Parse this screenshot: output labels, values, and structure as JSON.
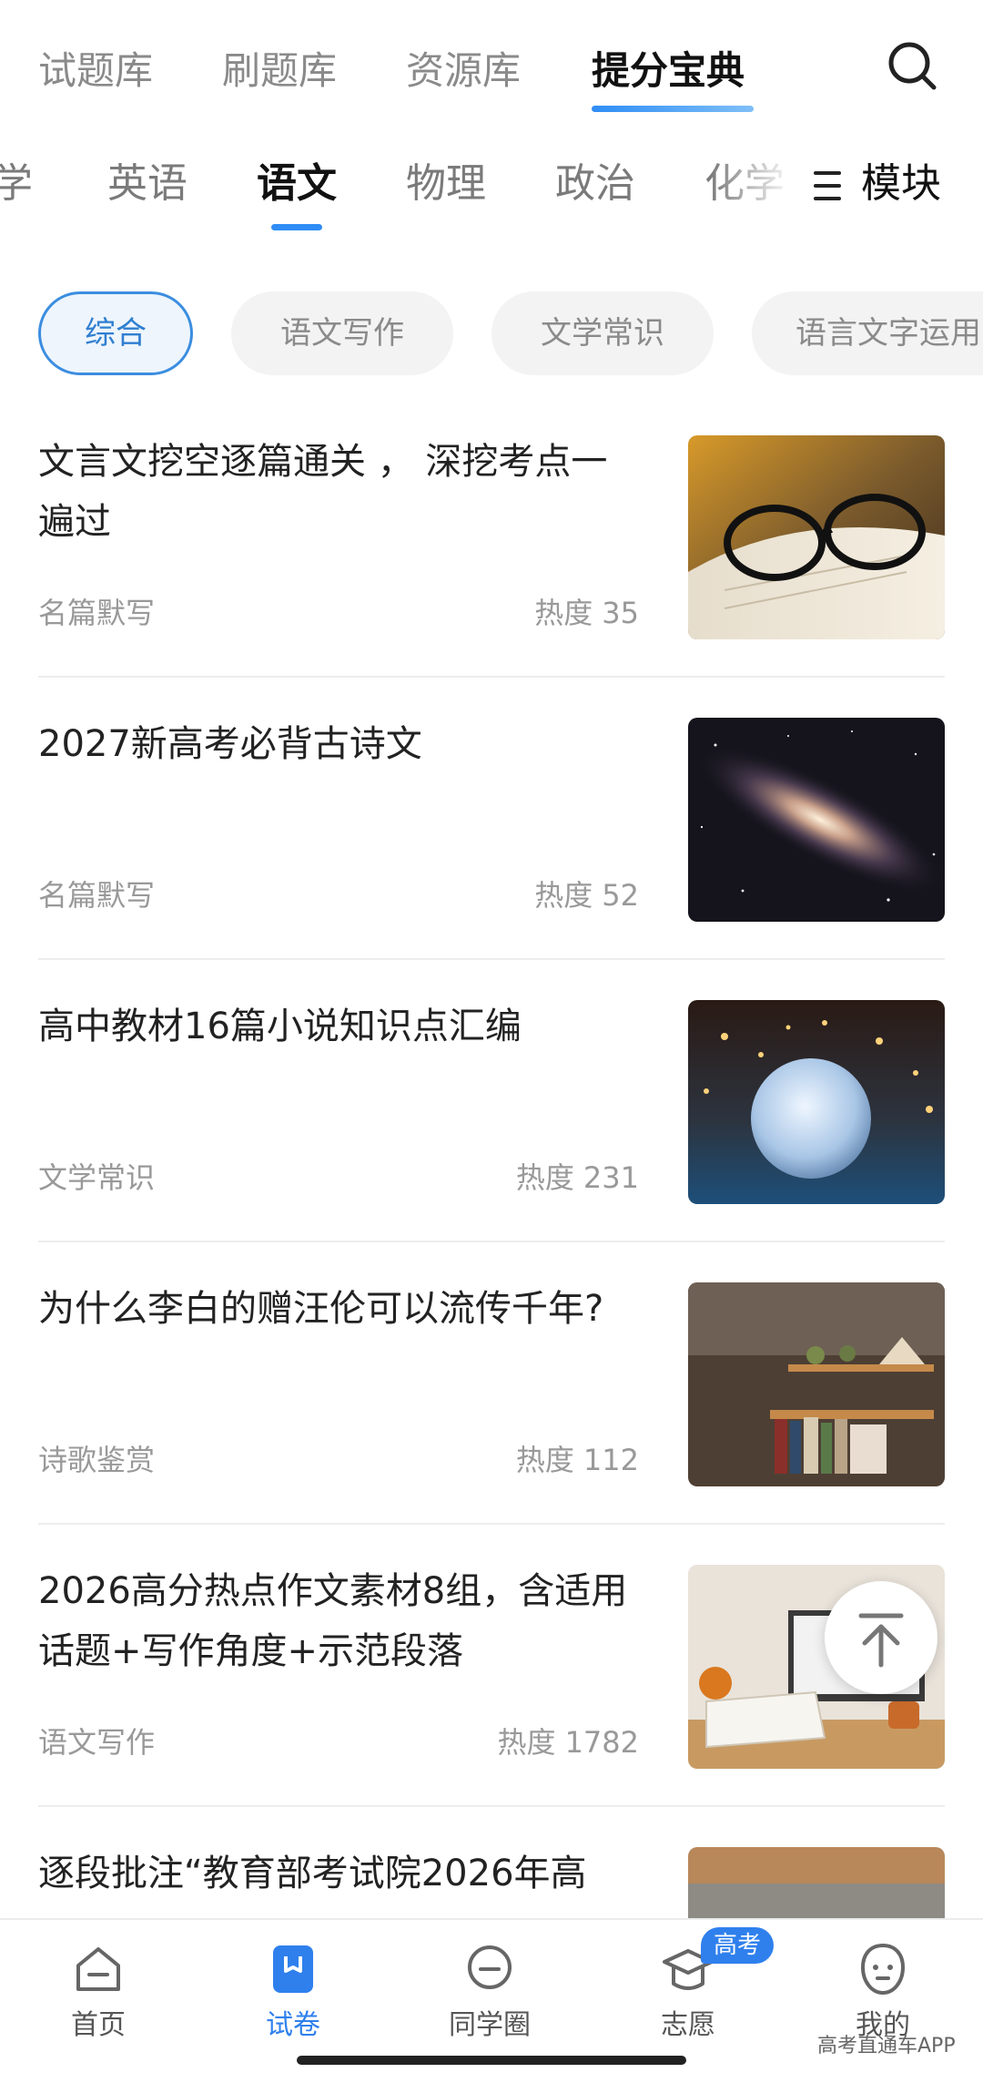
{
  "top_tabs": [
    {
      "label": "试题库",
      "active": false
    },
    {
      "label": "刷题库",
      "active": false
    },
    {
      "label": "资源库",
      "active": false
    },
    {
      "label": "提分宝典",
      "active": true
    }
  ],
  "subjects": [
    {
      "label": "学",
      "active": false
    },
    {
      "label": "英语",
      "active": false
    },
    {
      "label": "语文",
      "active": true
    },
    {
      "label": "物理",
      "active": false
    },
    {
      "label": "政治",
      "active": false
    },
    {
      "label": "化学",
      "active": false
    }
  ],
  "module_button": {
    "label": "模块",
    "icon": "menu-icon"
  },
  "filters": [
    {
      "label": "综合",
      "active": true
    },
    {
      "label": "语文写作",
      "active": false
    },
    {
      "label": "文学常识",
      "active": false
    },
    {
      "label": "语言文字运用",
      "active": false
    }
  ],
  "articles": [
    {
      "title": "文言文挖空逐篇通关 ， 深挖考点一遍过",
      "tag": "名篇默写",
      "heat_label": "热度",
      "heat": "35",
      "thumb": "glasses-on-book"
    },
    {
      "title": "2027新高考必背古诗文",
      "tag": "名篇默写",
      "heat_label": "热度",
      "heat": "52",
      "thumb": "galaxy"
    },
    {
      "title": "高中教材16篇小说知识点汇编",
      "tag": "文学常识",
      "heat_label": "热度",
      "heat": "231",
      "thumb": "moon-lamp"
    },
    {
      "title": "为什么李白的赠汪伦可以流传千年?",
      "tag": "诗歌鉴赏",
      "heat_label": "热度",
      "heat": "112",
      "thumb": "bookshelf"
    },
    {
      "title": "2026高分热点作文素材8组，含适用话题+写作角度+示范段落",
      "tag": "语文写作",
      "heat_label": "热度",
      "heat": "1782",
      "thumb": "desk-notebook"
    },
    {
      "title": "逐段批注“教育部考试院2026年高",
      "tag": "",
      "heat_label": "",
      "heat": "",
      "thumb": "reading-person"
    }
  ],
  "bottom_nav": [
    {
      "label": "首页",
      "icon": "home-icon",
      "active": false
    },
    {
      "label": "试卷",
      "icon": "paper-icon",
      "active": true
    },
    {
      "label": "同学圈",
      "icon": "chat-icon",
      "active": false
    },
    {
      "label": "志愿",
      "icon": "graduation-cap-icon",
      "active": false
    },
    {
      "label": "我的",
      "icon": "profile-icon",
      "active": false
    }
  ],
  "badge": "高考",
  "watermark": "高考直通车APP",
  "colors": {
    "accent": "#2f80ed",
    "active_chip_border": "#3b8de0",
    "muted_text": "#999999"
  }
}
